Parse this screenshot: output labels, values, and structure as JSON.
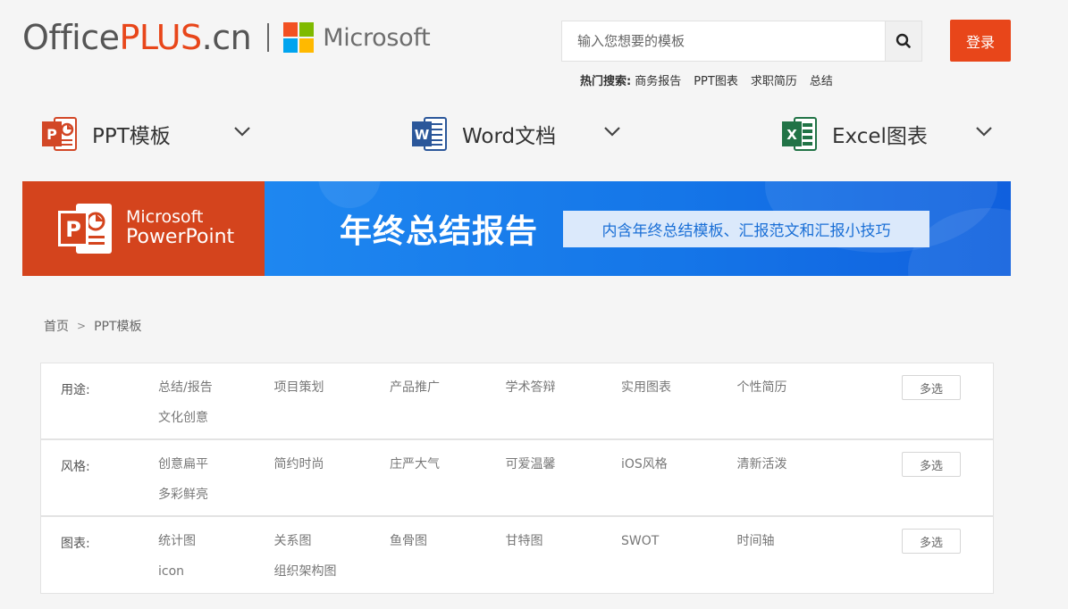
{
  "header": {
    "logo": {
      "office": "Office",
      "plus": "PLUS",
      "cn": ".cn",
      "microsoft": "Microsoft"
    },
    "search": {
      "placeholder": "输入您想要的模板",
      "value": ""
    },
    "login_label": "登录",
    "hot_search": {
      "label": "热门搜索:",
      "items": [
        "商务报告",
        "PPT图表",
        "求职简历",
        "总结"
      ]
    }
  },
  "categories": [
    {
      "label": "PPT模板",
      "letter": "P",
      "color": "#d24726"
    },
    {
      "label": "Word文档",
      "letter": "W",
      "color": "#2b579a"
    },
    {
      "label": "Excel图表",
      "letter": "X",
      "color": "#217346"
    }
  ],
  "banner": {
    "brand_line1": "Microsoft",
    "brand_line2": "PowerPoint",
    "title": "年终总结报告",
    "tag": "内含年终总结模板、汇报范文和汇报小技巧"
  },
  "breadcrumb": {
    "home": "首页",
    "separator": ">",
    "current": "PPT模板"
  },
  "filters": [
    {
      "label": "用途:",
      "options": [
        "总结/报告",
        "项目策划",
        "产品推广",
        "学术答辩",
        "实用图表",
        "个性简历",
        "文化创意"
      ],
      "multi_label": "多选"
    },
    {
      "label": "风格:",
      "options": [
        "创意扁平",
        "简约时尚",
        "庄严大气",
        "可爱温馨",
        "iOS风格",
        "清新活泼",
        "多彩鲜亮"
      ],
      "multi_label": "多选"
    },
    {
      "label": "图表:",
      "options": [
        "统计图",
        "关系图",
        "鱼骨图",
        "甘特图",
        "SWOT",
        "时间轴",
        "icon",
        "组织架构图"
      ],
      "multi_label": "多选"
    }
  ],
  "colors": {
    "accent": "#e8461a",
    "ppt_red": "#d4441d",
    "banner_blue": "#1576e8"
  }
}
